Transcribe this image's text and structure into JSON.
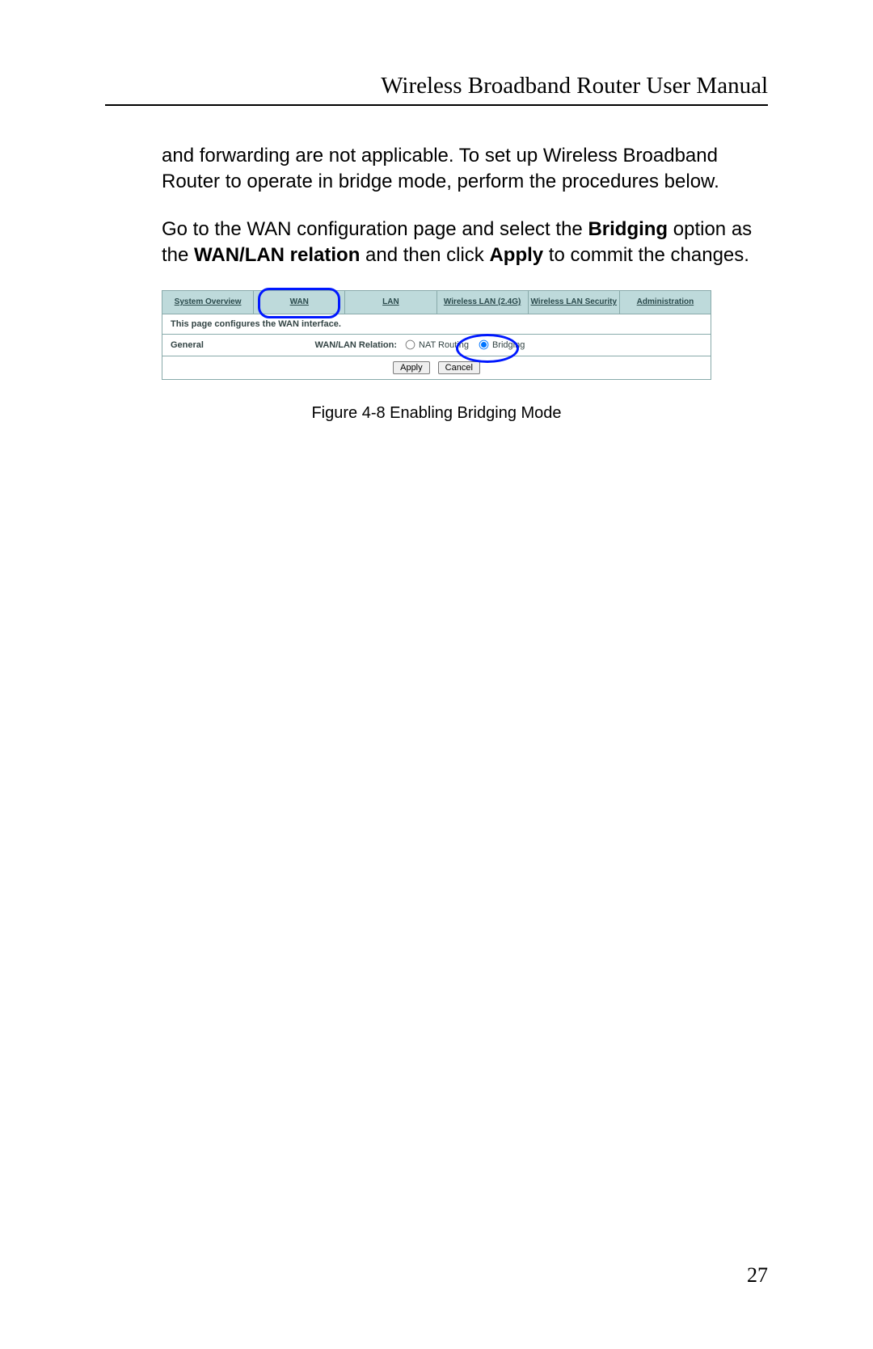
{
  "header": {
    "title": "Wireless Broadband Router User Manual"
  },
  "body": {
    "p1": "and forwarding are not applicable. To set up Wireless Broadband Router to operate in bridge mode, perform the procedures below.",
    "p2_pre": "Go to the WAN configuration page and select the ",
    "p2_b1": "Bridging",
    "p2_mid1": " option as the ",
    "p2_b2": "WAN/LAN relation",
    "p2_mid2": " and then click ",
    "p2_b3": "Apply",
    "p2_post": " to commit the changes."
  },
  "shot": {
    "tabs": {
      "system": "System Overview",
      "wan": "WAN",
      "lan": "LAN",
      "wlan": "Wireless LAN (2.4G)",
      "wsec": "Wireless LAN Security",
      "admin": "Administration"
    },
    "desc": "This page configures the WAN interface.",
    "row": {
      "general": "General",
      "relation": "WAN/LAN Relation:",
      "opt_nat": "NAT Routing",
      "opt_bridge": "Bridging"
    },
    "buttons": {
      "apply": "Apply",
      "cancel": "Cancel"
    }
  },
  "caption": "Figure 4-8  Enabling Bridging Mode",
  "page_number": "27"
}
